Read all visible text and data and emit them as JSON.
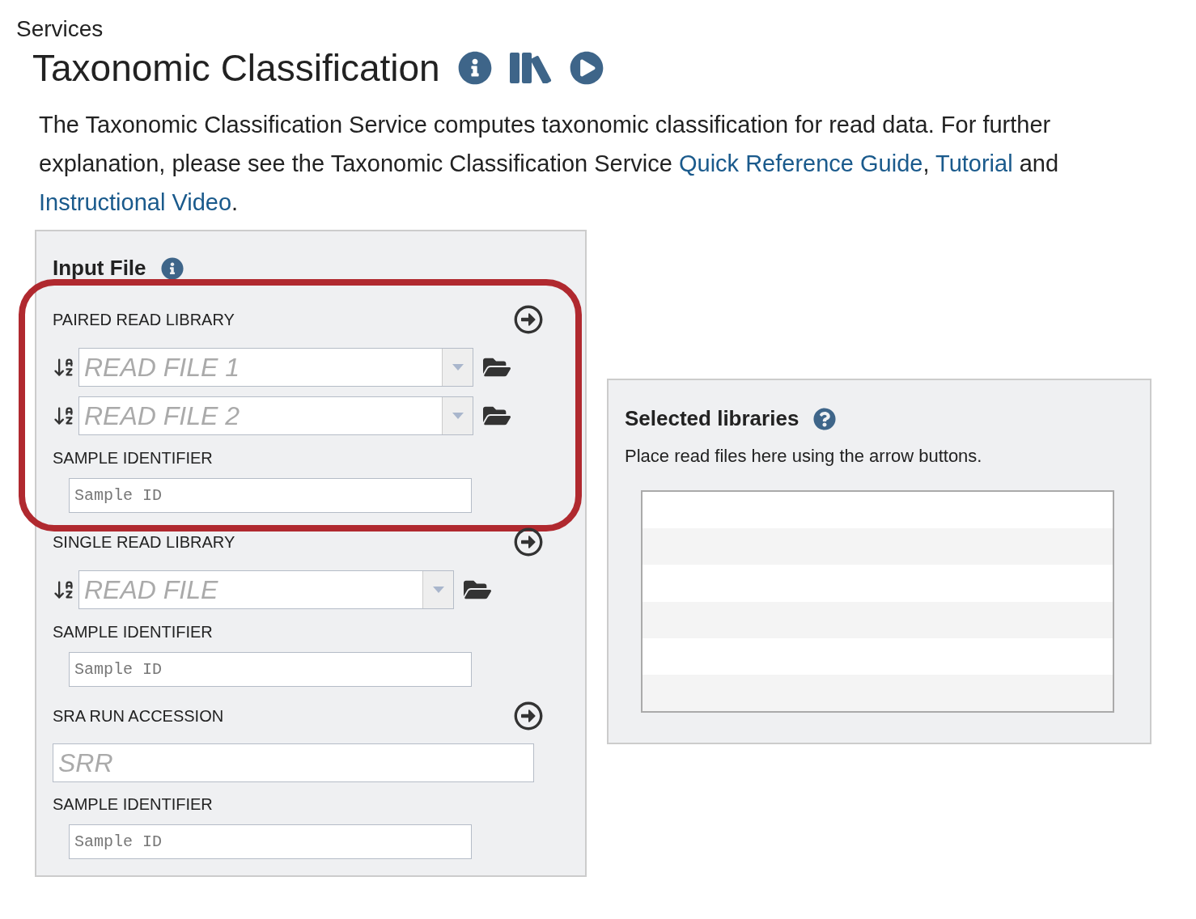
{
  "breadcrumb": "Services",
  "title": "Taxonomic Classification",
  "description": [
    {
      "kind": "text",
      "text": "The Taxonomic Classification Service computes taxonomic classification for read data. For further explanation, please see the Taxonomic Classification Service "
    },
    {
      "kind": "link",
      "text": "Quick Reference Guide"
    },
    {
      "kind": "text",
      "text": ", "
    },
    {
      "kind": "link",
      "text": "Tutorial"
    },
    {
      "kind": "text",
      "text": " and "
    },
    {
      "kind": "link",
      "text": "Instructional Video"
    },
    {
      "kind": "text",
      "text": "."
    }
  ],
  "input_file": {
    "title": "Input File",
    "sections": [
      {
        "heading": "PAIRED READ LIBRARY",
        "highlighted": true,
        "rows": [
          {
            "kind": "file",
            "placeholder": "READ FILE 1"
          },
          {
            "kind": "file",
            "placeholder": "READ FILE 2"
          },
          {
            "kind": "label",
            "text": "SAMPLE IDENTIFIER"
          },
          {
            "kind": "sample",
            "placeholder": "Sample ID"
          }
        ]
      },
      {
        "heading": "SINGLE READ LIBRARY",
        "highlighted": false,
        "rows": [
          {
            "kind": "file",
            "placeholder": "READ FILE"
          },
          {
            "kind": "label",
            "text": "SAMPLE IDENTIFIER"
          },
          {
            "kind": "sample",
            "placeholder": "Sample ID"
          }
        ]
      },
      {
        "heading": "SRA RUN ACCESSION",
        "highlighted": false,
        "rows": [
          {
            "kind": "accession",
            "placeholder": "SRR"
          },
          {
            "kind": "label",
            "text": "SAMPLE IDENTIFIER"
          },
          {
            "kind": "sample",
            "placeholder": "Sample ID"
          }
        ]
      }
    ]
  },
  "selected_libraries": {
    "title": "Selected libraries",
    "hint": "Place read files here using the arrow buttons."
  }
}
